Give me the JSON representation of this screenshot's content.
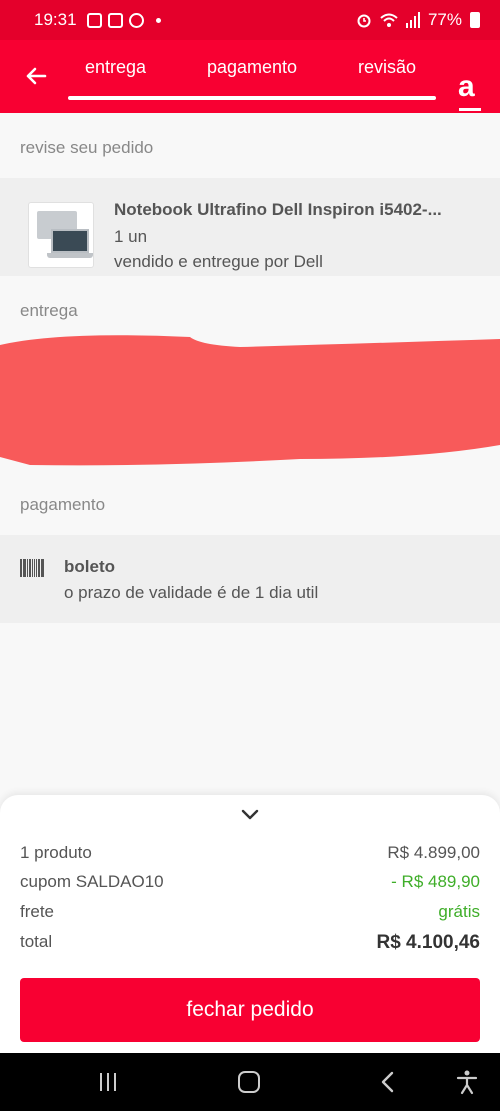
{
  "status_bar": {
    "time": "19:31",
    "battery": "77%"
  },
  "tabs": [
    "entrega",
    "pagamento",
    "revisão"
  ],
  "logo": "a",
  "review": {
    "label": "revise seu pedido",
    "product": {
      "name": "Notebook Ultrafino Dell Inspiron i5402-...",
      "quantity": "1 un",
      "seller": "vendido e entregue por Dell"
    }
  },
  "delivery": {
    "label": "entrega"
  },
  "payment": {
    "label": "pagamento",
    "method": "boleto",
    "note": "o prazo de validade é de 1 dia util"
  },
  "summary": {
    "products_label": "1 produto",
    "products_value": "R$ 4.899,00",
    "coupon_label": "cupom SALDAO10",
    "coupon_value": "- R$ 489,90",
    "shipping_label": "frete",
    "shipping_value": "grátis",
    "total_label": "total",
    "total_value": "R$ 4.100,46",
    "button": "fechar pedido"
  },
  "colors": {
    "brand": "#f80032",
    "discount": "#3fae29",
    "redaction": "#f85a5a"
  }
}
